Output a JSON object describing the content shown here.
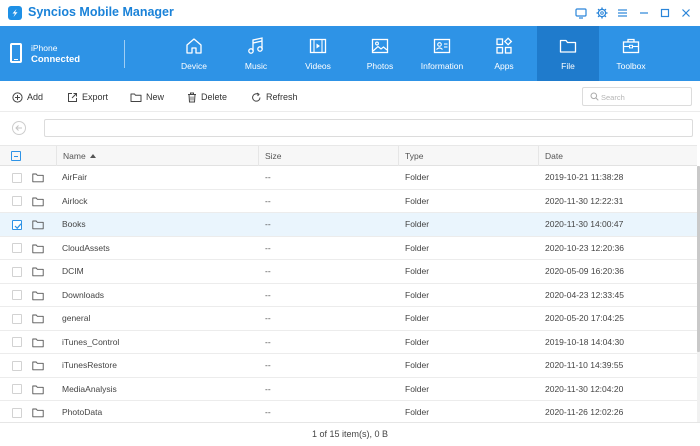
{
  "app": {
    "title": "Syncios Mobile Manager"
  },
  "window_controls": [
    "monitor-icon",
    "gear-icon",
    "menu-icon",
    "minimize-icon",
    "maximize-icon",
    "close-icon"
  ],
  "device": {
    "name": "iPhone",
    "status": "Connected"
  },
  "nav": {
    "tabs": [
      {
        "label": "Device",
        "icon": "home-icon"
      },
      {
        "label": "Music",
        "icon": "music-icon"
      },
      {
        "label": "Videos",
        "icon": "film-icon"
      },
      {
        "label": "Photos",
        "icon": "image-icon"
      },
      {
        "label": "Information",
        "icon": "contact-card-icon"
      },
      {
        "label": "Apps",
        "icon": "apps-icon"
      },
      {
        "label": "File",
        "icon": "folder-icon",
        "active": true
      },
      {
        "label": "Toolbox",
        "icon": "toolbox-icon"
      }
    ]
  },
  "toolbar": {
    "add": "Add",
    "export": "Export",
    "new": "New",
    "delete": "Delete",
    "refresh": "Refresh",
    "search_placeholder": "Search"
  },
  "path": {
    "value": ""
  },
  "table": {
    "columns": {
      "name": "Name",
      "size": "Size",
      "type": "Type",
      "date": "Date"
    },
    "sort": {
      "column": "Name",
      "direction": "ascending"
    },
    "rows": [
      {
        "name": "AirFair",
        "size": "--",
        "type": "Folder",
        "date": "2019-10-21 11:38:28",
        "selected": false
      },
      {
        "name": "Airlock",
        "size": "--",
        "type": "Folder",
        "date": "2020-11-30 12:22:31",
        "selected": false
      },
      {
        "name": "Books",
        "size": "--",
        "type": "Folder",
        "date": "2020-11-30 14:00:47",
        "selected": true
      },
      {
        "name": "CloudAssets",
        "size": "--",
        "type": "Folder",
        "date": "2020-10-23 12:20:36",
        "selected": false
      },
      {
        "name": "DCIM",
        "size": "--",
        "type": "Folder",
        "date": "2020-05-09 16:20:36",
        "selected": false
      },
      {
        "name": "Downloads",
        "size": "--",
        "type": "Folder",
        "date": "2020-04-23 12:33:45",
        "selected": false
      },
      {
        "name": "general",
        "size": "--",
        "type": "Folder",
        "date": "2020-05-20 17:04:25",
        "selected": false
      },
      {
        "name": "iTunes_Control",
        "size": "--",
        "type": "Folder",
        "date": "2019-10-18 14:04:30",
        "selected": false
      },
      {
        "name": "iTunesRestore",
        "size": "--",
        "type": "Folder",
        "date": "2020-11-10 14:39:55",
        "selected": false
      },
      {
        "name": "MediaAnalysis",
        "size": "--",
        "type": "Folder",
        "date": "2020-11-30 12:04:20",
        "selected": false
      },
      {
        "name": "PhotoData",
        "size": "--",
        "type": "Folder",
        "date": "2020-11-26 12:02:26",
        "selected": false
      }
    ]
  },
  "status": {
    "text": "1 of 15 item(s), 0 B"
  },
  "colors": {
    "accent": "#2e93e6",
    "active_tab": "#1f7bcc",
    "brand": "#1a82d8",
    "selected_row": "#eaf5fd"
  }
}
